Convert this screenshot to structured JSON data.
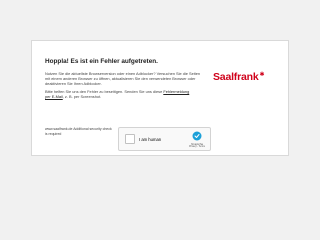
{
  "error": {
    "title": "Hoppla! Es ist ein Fehler aufgetreten.",
    "paragraph1": "Nutzen Sie die aktuellste Browserversion oder einen Adblocker? Versuchen Sie die Seiten mit einem anderen Browser zu öffnen, aktualisieren Sie den verwendeten Browser oder deaktivieren Sie Ihren Adblocker.",
    "paragraph2_before": "Bitte helfen Sie uns den Fehler zu beseitigen. Senden Sie uns diese ",
    "paragraph2_link": "Fehlermeldung per E-Mail",
    "paragraph2_after": ", z. B. per Screenshot."
  },
  "brand": {
    "logo_text": "Saalfrank",
    "logo_mark": "✱",
    "color": "#d0021b"
  },
  "security": {
    "note": "www.saalfrank.de Additional security check is required"
  },
  "captcha": {
    "label": "I am human",
    "brand_name": "hCaptcha",
    "links": "Privacy - Terms",
    "icon": "recaptcha-icon"
  }
}
